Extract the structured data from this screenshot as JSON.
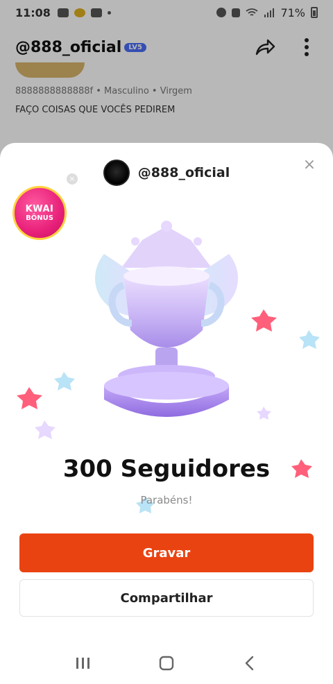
{
  "status_bar": {
    "time": "11:08",
    "battery": "71%"
  },
  "profile": {
    "handle": "@888_oficial",
    "level_badge": "LV5",
    "info": "8888888888888f • Masculino • Virgem",
    "bio": "FAÇO COISAS QUE VOCÊS PEDIREM"
  },
  "sheet": {
    "handle": "@888_oficial",
    "kwai_badge": {
      "line1": "KWAI",
      "line2": "BÔNUS"
    },
    "title": "300 Seguidores",
    "subtitle": "Parabéns!",
    "primary_button": "Gravar",
    "secondary_button": "Compartilhar"
  },
  "colors": {
    "primary": "#ea4312",
    "kwai_pink": "#e8207a"
  },
  "icons": {
    "share": "share-icon",
    "more": "more-vertical-icon",
    "close": "close-icon",
    "recents": "recents-icon",
    "home": "home-icon",
    "back": "back-icon"
  }
}
